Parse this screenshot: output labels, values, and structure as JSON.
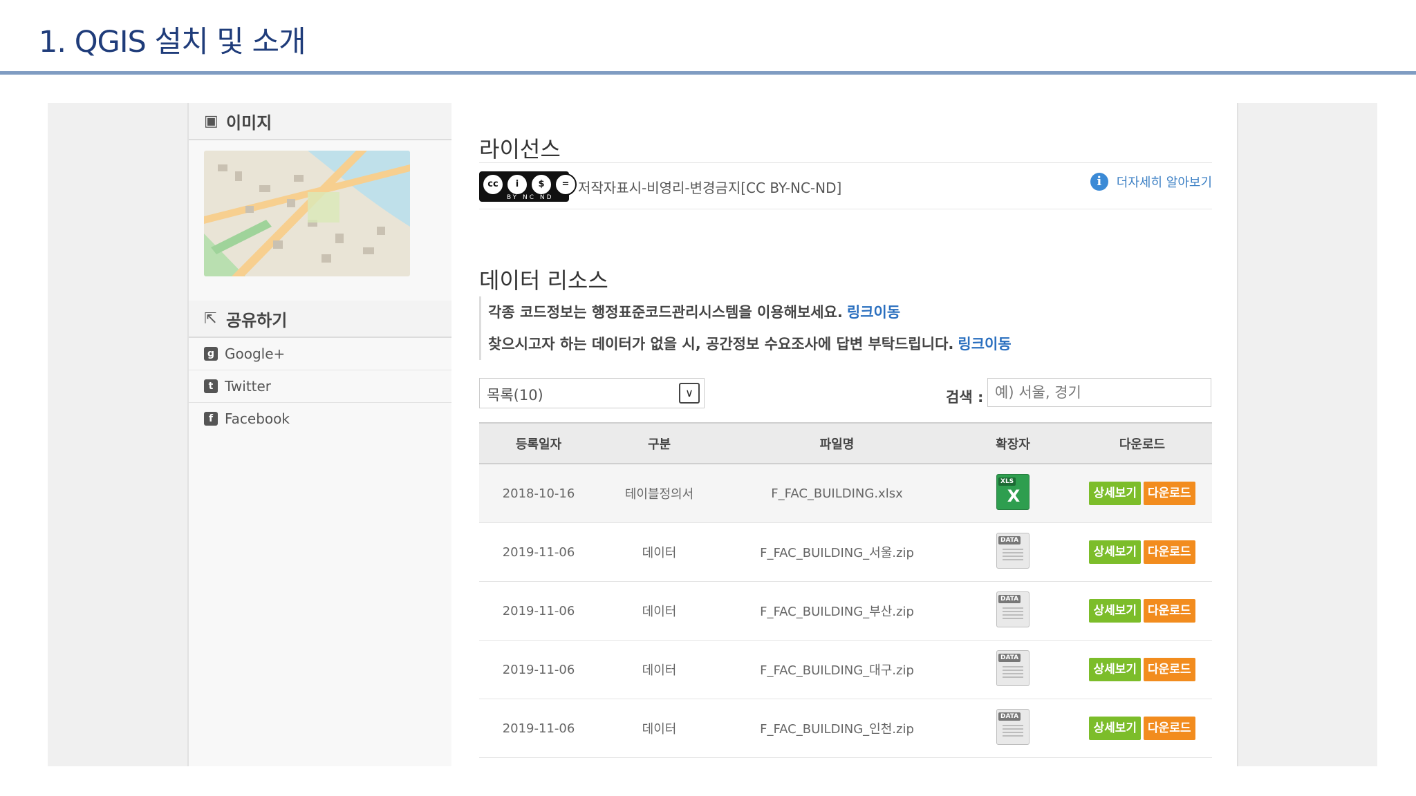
{
  "slide": {
    "title": "1. QGIS 설치 및 소개"
  },
  "sidebar": {
    "image_section": {
      "label": "이미지",
      "icon": "image-icon"
    },
    "share_section": {
      "label": "공유하기",
      "icon": "share-icon"
    },
    "share_items": [
      {
        "label": "Google+",
        "icon": "google-plus-icon"
      },
      {
        "label": "Twitter",
        "icon": "twitter-icon"
      },
      {
        "label": "Facebook",
        "icon": "facebook-icon"
      }
    ]
  },
  "license": {
    "title": "라이선스",
    "badge_sub": "BY NC ND",
    "text": "저작자표시-비영리-변경금지[CC BY-NC-ND]",
    "more_label": "더자세히 알아보기",
    "info_glyph": "i"
  },
  "resources": {
    "title": "데이터 리소스",
    "notice1": "각종 코드정보는 행정표준코드관리시스템을 이용해보세요.",
    "notice2": "찾으시고자 하는 데이터가 없을 시, 공간정보 수요조사에 답변 부탁드립니다.",
    "link_label": "링크이동",
    "select_value": "목록(10)",
    "select_arrow": "∨",
    "search_label": "검색 :",
    "search_placeholder": "예) 서울, 경기",
    "columns": [
      "등록일자",
      "구분",
      "파일명",
      "확장자",
      "다운로드"
    ],
    "rows": [
      {
        "date": "2018-10-16",
        "type": "테이블정의서",
        "file": "F_FAC_BUILDING.xlsx",
        "ext_tag": "XLS",
        "ext_mark": "X"
      },
      {
        "date": "2019-11-06",
        "type": "데이터",
        "file": "F_FAC_BUILDING_서울.zip",
        "ext_tag": "DATA"
      },
      {
        "date": "2019-11-06",
        "type": "데이터",
        "file": "F_FAC_BUILDING_부산.zip",
        "ext_tag": "DATA"
      },
      {
        "date": "2019-11-06",
        "type": "데이터",
        "file": "F_FAC_BUILDING_대구.zip",
        "ext_tag": "DATA"
      },
      {
        "date": "2019-11-06",
        "type": "데이터",
        "file": "F_FAC_BUILDING_인천.zip",
        "ext_tag": "DATA"
      }
    ],
    "detail_label": "상세보기",
    "download_label": "다운로드"
  }
}
